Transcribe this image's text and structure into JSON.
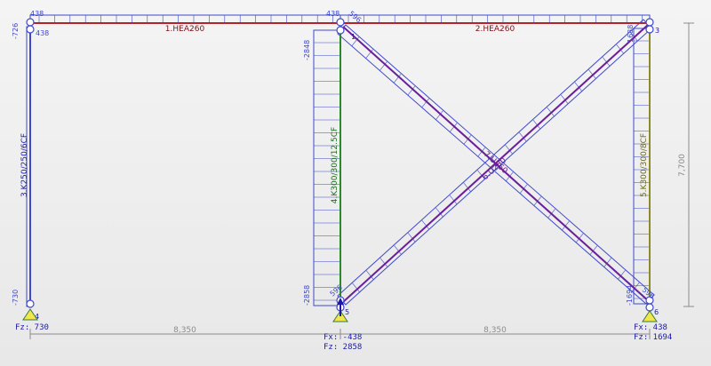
{
  "colors": {
    "background": "#eeeeee",
    "diagram": "#3f48cc",
    "beam": "#b4232a",
    "member_label": "#7d0f17",
    "column_green": "#2a8a2a",
    "column_olive": "#8b8b2a",
    "brace": "#6a1f9a",
    "support": "#f2e64d",
    "dimension": "#8c8c8c",
    "reaction": "#1a1aa6"
  },
  "members": {
    "beam_1": "1.HEA260",
    "beam_2": "2.HEA260",
    "column_3": "3.K250/250/6CF",
    "column_4": "4.K300/300/12.5CF",
    "column_5": "5.K300/300/8CF",
    "brace_6": "6.U260",
    "brace_7": "7.U260"
  },
  "node_numbers": {
    "n1": "1",
    "n3": "3",
    "n4": "4",
    "n5": "5",
    "n6": "6"
  },
  "values": {
    "top_left_1": "438",
    "top_left_2": "438",
    "left_col_top": "-726",
    "left_col_bottom": "-730",
    "top_mid": "438",
    "top_mid_2": "596",
    "mid_col_top": "-2848",
    "mid_col_bottom": "-2858",
    "mid_base": "596",
    "right_top": "1688",
    "right_bottom": "-1694",
    "right_base": "596"
  },
  "reactions": {
    "left_fz": "Fz: 730",
    "mid_fx": "Fx: -438",
    "mid_fz": "Fz: 2858",
    "right_fx": "Fx: 438",
    "right_fz": "Fz: 1694"
  },
  "dimensions": {
    "span_left": "8,350",
    "span_right": "8,350",
    "height": "7,700"
  }
}
